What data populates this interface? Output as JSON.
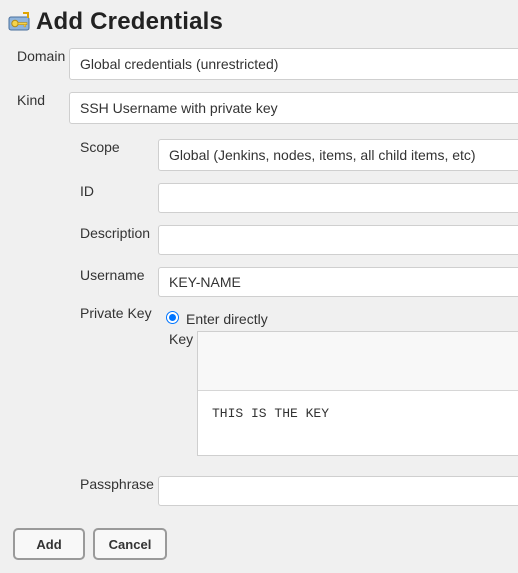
{
  "header": {
    "title": "Add Credentials",
    "icon": "key-icon"
  },
  "form": {
    "domain": {
      "label": "Domain",
      "value": "Global credentials (unrestricted)"
    },
    "kind": {
      "label": "Kind",
      "value": "SSH Username with private key"
    },
    "scope": {
      "label": "Scope",
      "value": "Global (Jenkins, nodes, items, all child items, etc)"
    },
    "id": {
      "label": "ID",
      "value": ""
    },
    "description": {
      "label": "Description",
      "value": ""
    },
    "username": {
      "label": "Username",
      "value": "KEY-NAME"
    },
    "private_key": {
      "label": "Private Key",
      "option_label": "Enter directly",
      "key_label": "Key",
      "key_value": "THIS IS THE KEY"
    },
    "passphrase": {
      "label": "Passphrase",
      "value": ""
    }
  },
  "buttons": {
    "add_label": "Add",
    "cancel_label": "Cancel"
  },
  "colors": {
    "background": "#f0f0f0",
    "radio_accent": "#0075ff"
  }
}
